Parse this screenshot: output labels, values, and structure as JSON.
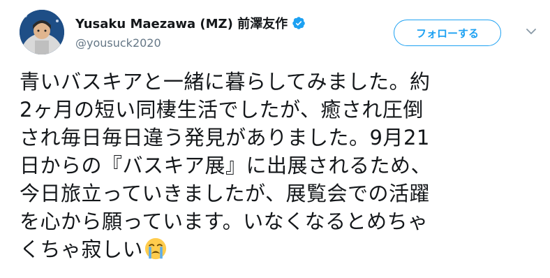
{
  "user": {
    "name": "Yusaku Maezawa (MZ) 前澤友作",
    "handle": "@yousuck2020",
    "verified_icon": "verified-badge-icon",
    "avatar_icon": "avatar"
  },
  "actions": {
    "follow_label": "フォローする",
    "more_icon": "chevron-down-icon"
  },
  "tweet": {
    "lines": [
      "青いバスキアと一緒に暮らしてみました。約",
      "2ヶ月の短い同棲生活でしたが、癒され圧倒",
      "され毎日毎日違う発見がありました。9月21",
      "日からの『バスキア展』に出展されるため、",
      "今日旅立っていきましたが、展覧会での活躍",
      "を心から願っています。いなくなるとめちゃ",
      "くちゃ寂しい"
    ],
    "trailing_emoji": "loudly-crying-face-icon"
  },
  "colors": {
    "accent": "#1da1f2",
    "text": "#14171a",
    "secondary": "#657786"
  }
}
